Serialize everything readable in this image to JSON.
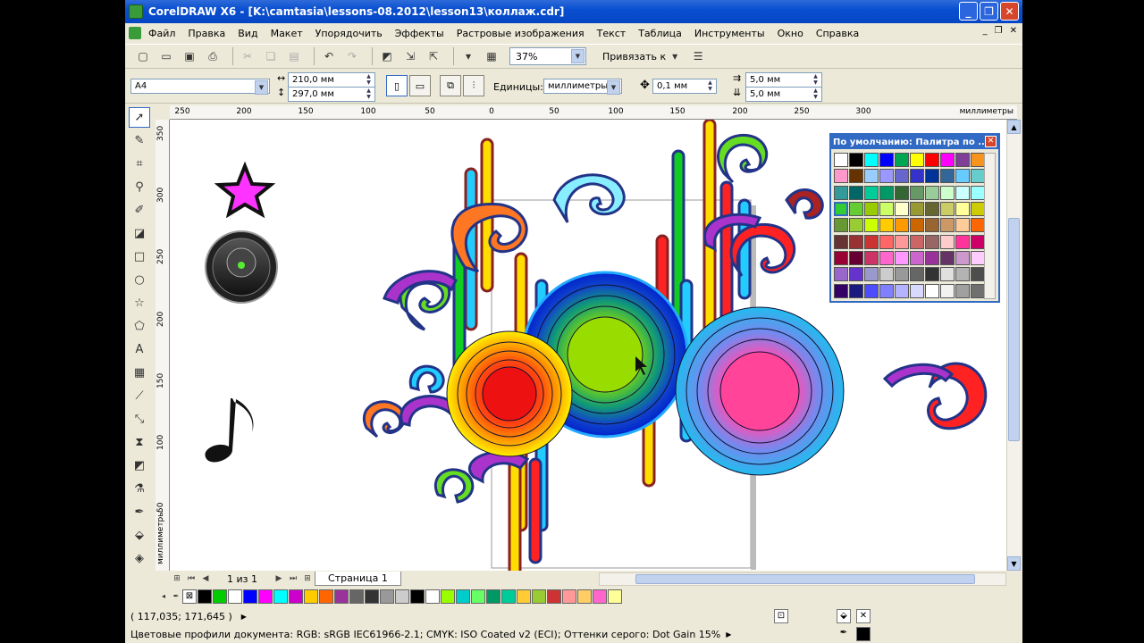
{
  "window": {
    "title": "CorelDRAW X6 - [K:\\camtasia\\lessons-08.2012\\lesson13\\коллаж.cdr]"
  },
  "menu": [
    "Файл",
    "Правка",
    "Вид",
    "Макет",
    "Упорядочить",
    "Эффекты",
    "Растровые изображения",
    "Текст",
    "Таблица",
    "Инструменты",
    "Окно",
    "Справка"
  ],
  "toolbar": {
    "zoom": "37%",
    "snap_label": "Привязать к"
  },
  "propbar": {
    "page_size": "A4",
    "width": "210,0 мм",
    "height": "297,0 мм",
    "units_label": "Единицы:",
    "units_value": "миллиметры",
    "nudge": "0,1 мм",
    "dup_x": "5,0 мм",
    "dup_y": "5,0 мм"
  },
  "rulers": {
    "h_ticks": [
      "250",
      "200",
      "150",
      "100",
      "50",
      "0",
      "50",
      "100",
      "150",
      "200",
      "250",
      "300"
    ],
    "h_unit": "миллиметры",
    "v_ticks": [
      "350",
      "300",
      "250",
      "200",
      "150",
      "100",
      "50"
    ],
    "v_unit": "миллиметры"
  },
  "pagenav": {
    "counter": "1 из 1",
    "page_tab": "Страница 1"
  },
  "docker": {
    "title": "По умолчанию: Палитра по ...",
    "colors": [
      "#ffffff",
      "#000000",
      "#00ffff",
      "#0000ff",
      "#00a651",
      "#ffff00",
      "#ff0000",
      "#ff00ff",
      "#7f3f98",
      "#f7941d",
      "#ff99cc",
      "#663300",
      "#99ccff",
      "#9999ff",
      "#6666cc",
      "#3333cc",
      "#003399",
      "#336699",
      "#66ccff",
      "#66cccc",
      "#339999",
      "#006666",
      "#00cc99",
      "#009966",
      "#336633",
      "#669966",
      "#99cc99",
      "#ccffcc",
      "#ccffff",
      "#99ffff",
      "#33cc33",
      "#66cc33",
      "#99cc00",
      "#ccff66",
      "#ffffcc",
      "#999933",
      "#666633",
      "#cccc66",
      "#ffff99",
      "#cccc00",
      "#669933",
      "#99cc33",
      "#ccff00",
      "#ffcc00",
      "#ff9900",
      "#cc6600",
      "#996633",
      "#cc9966",
      "#ffcc99",
      "#ff6600",
      "#663333",
      "#993333",
      "#cc3333",
      "#ff6666",
      "#ff9999",
      "#cc6666",
      "#996666",
      "#ffcccc",
      "#ff3399",
      "#cc0066",
      "#990033",
      "#660033",
      "#cc3366",
      "#ff66cc",
      "#ff99ff",
      "#cc66cc",
      "#993399",
      "#663366",
      "#cc99cc",
      "#ffccff",
      "#9966cc",
      "#6633cc",
      "#9999cc",
      "#cccccc",
      "#999999",
      "#666666",
      "#333333",
      "#e0e0e0",
      "#b3b3b3",
      "#4d4d4d",
      "#330066",
      "#1a1a80",
      "#4d4dff",
      "#8080ff",
      "#b3b3ff",
      "#d9d9ff",
      "#ffffff",
      "#f2f2f2",
      "#a0a0a0",
      "#707070"
    ]
  },
  "colorstrip": [
    "#000000",
    "#00cc00",
    "#ffffff",
    "#0000ff",
    "#ff00ff",
    "#00ffff",
    "#cc00cc",
    "#ffcc00",
    "#ff6600",
    "#993399",
    "#666666",
    "#333333",
    "#999999",
    "#cccccc",
    "#000000",
    "#ffffff",
    "#99ff00",
    "#00cccc",
    "#66ff66",
    "#009966",
    "#00cc99",
    "#ffcc33",
    "#99cc33",
    "#cc3333",
    "#ff9999",
    "#ffcc66",
    "#ff66cc",
    "#ffff99"
  ],
  "status": {
    "coords": "( 117,035; 171,645 )",
    "profiles": "Цветовые профили документа: RGB: sRGB IEC61966-2.1; CMYK: ISO Coated v2 (ECI); Оттенки серого: Dot Gain 15%"
  }
}
